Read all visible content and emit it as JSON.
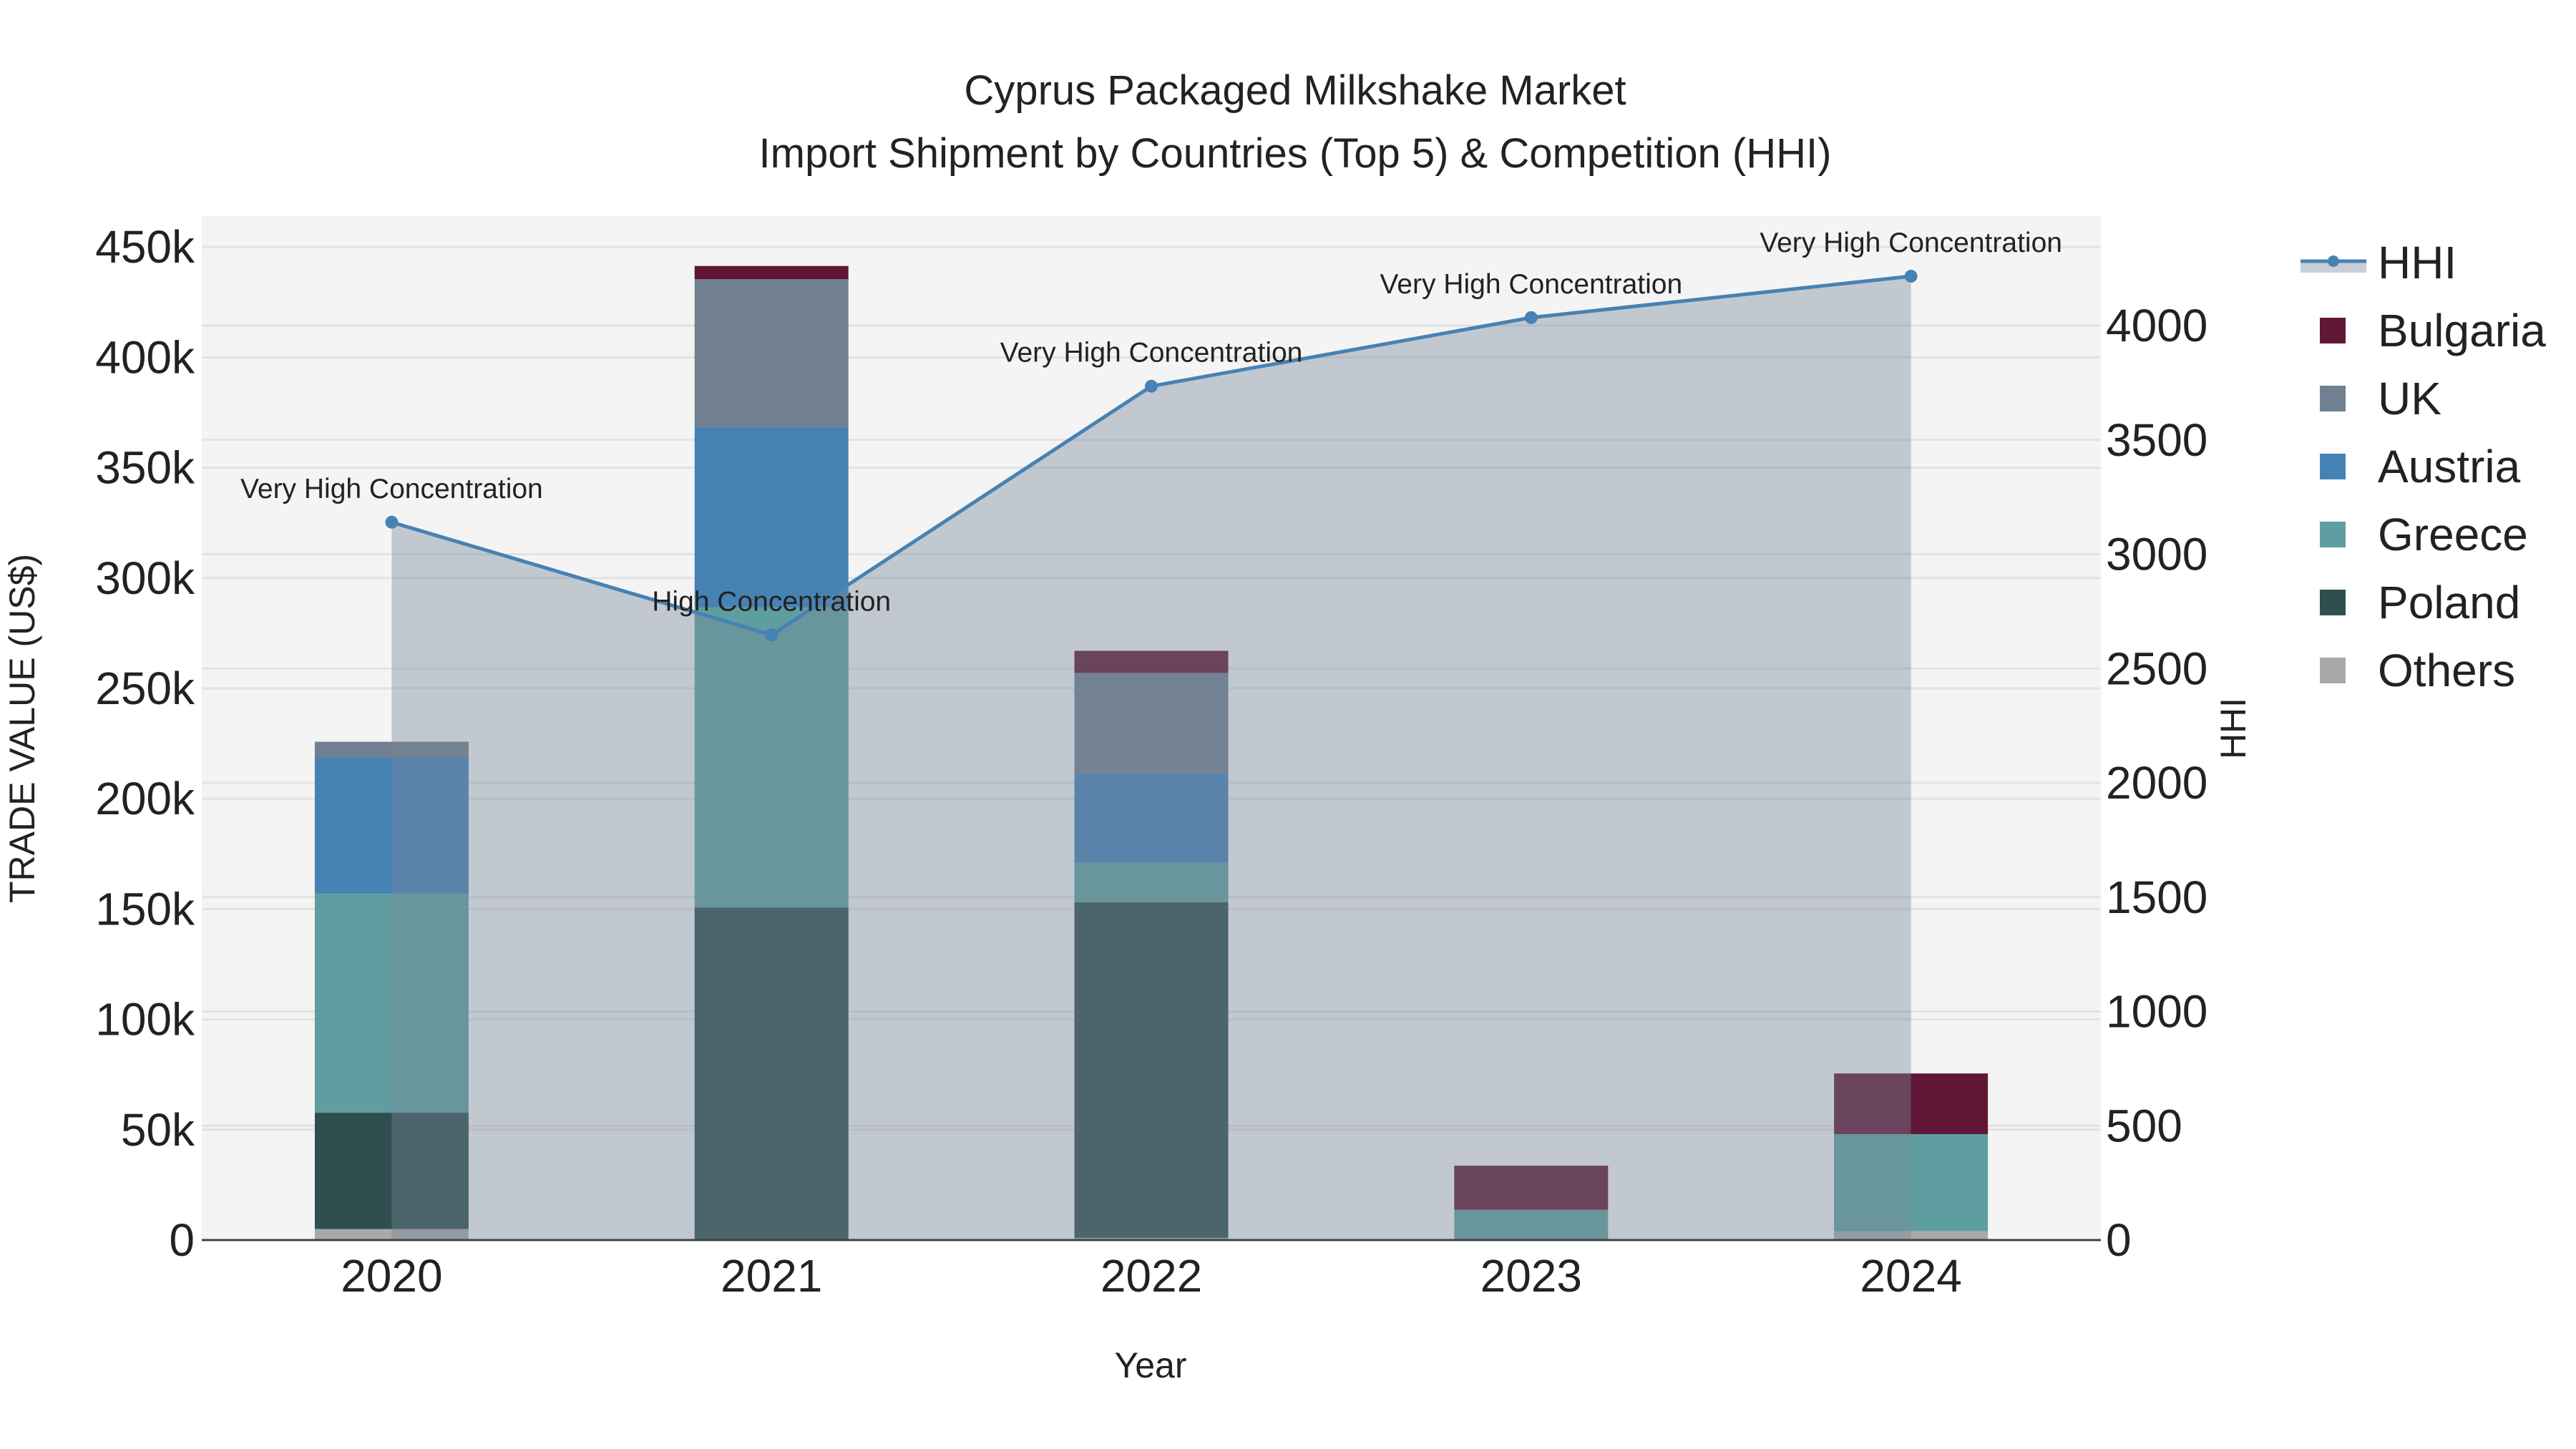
{
  "chart_data": {
    "type": "bar",
    "title": "Cyprus Packaged Milkshake Market",
    "subtitle": "Import Shipment by Countries (Top 5) & Competition (HHI)",
    "xlabel": "Year",
    "ylabel": "TRADE VALUE (US$)",
    "y2label": "HHI",
    "categories": [
      "2020",
      "2021",
      "2022",
      "2023",
      "2024"
    ],
    "ylim": [
      0,
      464000
    ],
    "y2lim": [
      0,
      4479
    ],
    "yticks": [
      0,
      50000,
      100000,
      150000,
      200000,
      250000,
      300000,
      350000,
      400000,
      450000
    ],
    "ytick_labels": [
      "0",
      "50k",
      "100k",
      "150k",
      "200k",
      "250k",
      "300k",
      "350k",
      "400k",
      "450k"
    ],
    "y2ticks": [
      0,
      500,
      1000,
      1500,
      2000,
      2500,
      3000,
      3500,
      4000
    ],
    "y2tick_labels": [
      "0",
      "500",
      "1000",
      "1500",
      "2000",
      "2500",
      "3000",
      "3500",
      "4000"
    ],
    "grid": true,
    "legend_position": "right",
    "stacked": true,
    "series": [
      {
        "name": "Others",
        "color": "#a9a9a9",
        "values": [
          5000,
          0,
          1000,
          0,
          4000
        ]
      },
      {
        "name": "Poland",
        "color": "#2f4f4f",
        "values": [
          52700,
          150700,
          152100,
          0,
          0
        ]
      },
      {
        "name": "Greece",
        "color": "#5f9ea0",
        "values": [
          99200,
          136100,
          17800,
          13700,
          44000
        ]
      },
      {
        "name": "Austria",
        "color": "#4682b4",
        "values": [
          61800,
          81600,
          40600,
          0,
          0
        ]
      },
      {
        "name": "UK",
        "color": "#708090",
        "values": [
          7100,
          67000,
          45500,
          0,
          0
        ]
      },
      {
        "name": "Bulgaria",
        "color": "#611635",
        "values": [
          0,
          6000,
          10000,
          20000,
          27500
        ]
      }
    ],
    "hhi": {
      "name": "HHI",
      "color": "#4682b4",
      "fill": "rgba(119,136,153,0.4)",
      "values": [
        3140,
        2647,
        3735,
        4035,
        4216
      ],
      "annotations": [
        "Very High Concentration",
        "High Concentration",
        "Very High Concentration",
        "Very High Concentration",
        "Very High Concentration"
      ]
    },
    "legend": [
      "HHI",
      "Bulgaria",
      "UK",
      "Austria",
      "Greece",
      "Poland",
      "Others"
    ]
  }
}
